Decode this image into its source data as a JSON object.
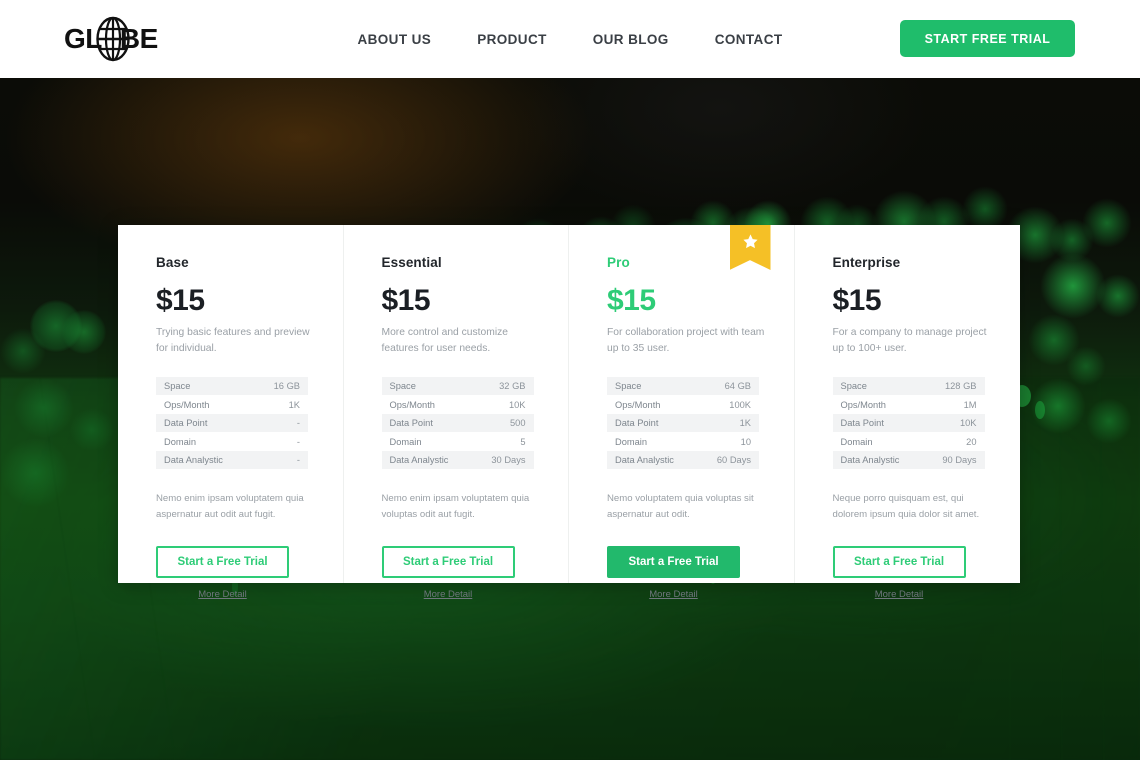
{
  "header": {
    "logo_text_left": "GL",
    "logo_icon": "globe-icon",
    "logo_text_right": "BE",
    "nav": [
      {
        "label": "ABOUT US"
      },
      {
        "label": "PRODUCT"
      },
      {
        "label": "OUR BLOG"
      },
      {
        "label": "CONTACT"
      }
    ],
    "cta_label": "START FREE TRIAL",
    "cta_color": "#1fbd6b"
  },
  "theme": {
    "accent_green": "#2ecc77",
    "button_green": "#22b96c",
    "ribbon_gold": "#f5c026",
    "row_shade": "#f2f3f4",
    "text_dark": "#22262b",
    "text_muted": "#9aa0a6"
  },
  "pricing": {
    "feature_labels": [
      "Space",
      "Ops/Month",
      "Data Point",
      "Domain",
      "Data Analystic"
    ],
    "plans": [
      {
        "name": "Base",
        "price": "$15",
        "description": "Trying basic features and preview for individual.",
        "featured": false,
        "values": [
          "16 GB",
          "1K",
          "-",
          "-",
          "-"
        ],
        "note": "Nemo enim ipsam voluptatem quia aspernatur aut odit aut fugit.",
        "button_label": "Start a Free Trial",
        "more_label": "More Detail"
      },
      {
        "name": "Essential",
        "price": "$15",
        "description": "More control and customize features for user needs.",
        "featured": false,
        "values": [
          "32 GB",
          "10K",
          "500",
          "5",
          "30 Days"
        ],
        "note": "Nemo enim ipsam voluptatem quia voluptas odit aut fugit.",
        "button_label": "Start a Free Trial",
        "more_label": "More Detail"
      },
      {
        "name": "Pro",
        "price": "$15",
        "description": "For collaboration project with team up to 35 user.",
        "featured": true,
        "badge_icon": "star-icon",
        "values": [
          "64 GB",
          "100K",
          "1K",
          "10",
          "60 Days"
        ],
        "note": "Nemo voluptatem quia voluptas sit aspernatur aut odit.",
        "button_label": "Start a Free Trial",
        "more_label": "More Detail"
      },
      {
        "name": "Enterprise",
        "price": "$15",
        "description": "For a company to manage project up to 100+ user.",
        "featured": false,
        "values": [
          "128 GB",
          "1M",
          "10K",
          "20",
          "90 Days"
        ],
        "note": "Neque porro quisquam est, qui dolorem ipsum quia dolor sit amet.",
        "button_label": "Start a Free Trial",
        "more_label": "More Detail"
      }
    ]
  }
}
